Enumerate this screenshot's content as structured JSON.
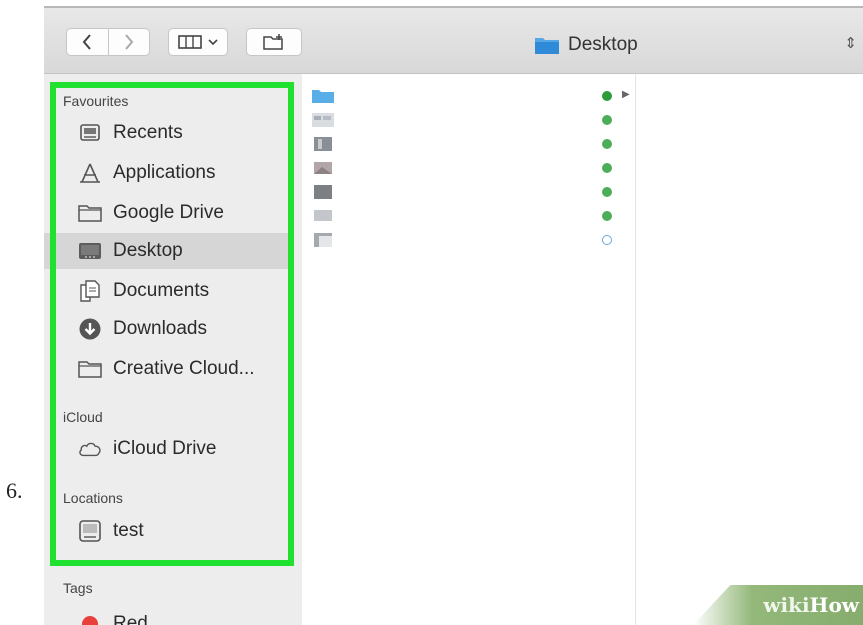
{
  "step_number": "6.",
  "toolbar": {
    "path_label": "Desktop"
  },
  "sidebar": {
    "favourites_title": "Favourites",
    "favourites": [
      {
        "label": "Recents",
        "icon": "recents-icon"
      },
      {
        "label": "Applications",
        "icon": "applications-icon"
      },
      {
        "label": "Google Drive",
        "icon": "folder-icon"
      },
      {
        "label": "Desktop",
        "icon": "desktop-icon",
        "selected": true
      },
      {
        "label": "Documents",
        "icon": "documents-icon"
      },
      {
        "label": "Downloads",
        "icon": "downloads-icon"
      },
      {
        "label": "Creative Cloud...",
        "icon": "folder-icon"
      }
    ],
    "icloud_title": "iCloud",
    "icloud": [
      {
        "label": "iCloud Drive",
        "icon": "cloud-icon"
      }
    ],
    "locations_title": "Locations",
    "locations": [
      {
        "label": "test",
        "icon": "disk-icon"
      }
    ],
    "tags_title": "Tags",
    "tags": [
      {
        "label": "Red",
        "color": "#e8403a"
      }
    ]
  },
  "highlight_color": "#20e030",
  "files": [
    {
      "thumb": "blue-folder",
      "status": "synced"
    },
    {
      "thumb": "image",
      "status": "synced"
    },
    {
      "thumb": "image",
      "status": "synced"
    },
    {
      "thumb": "image",
      "status": "synced"
    },
    {
      "thumb": "image",
      "status": "synced"
    },
    {
      "thumb": "image",
      "status": "synced"
    },
    {
      "thumb": "image",
      "status": "syncing"
    }
  ],
  "watermark": {
    "part1": "wiki",
    "part2": "How"
  }
}
